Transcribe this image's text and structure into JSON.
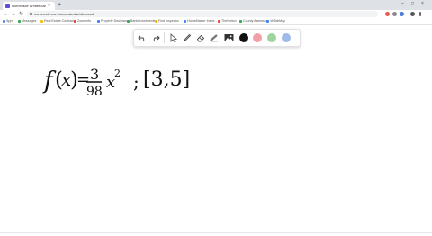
{
  "browser": {
    "tab_title": "Numerade Whiteboard",
    "tab_close": "×",
    "new_tab": "+",
    "url": "numerade.com/uncurated/whiteboard",
    "back": "←",
    "forward": "→",
    "reload": "↻",
    "min": "–",
    "max": "□",
    "close": "×"
  },
  "bookmarks": [
    {
      "label": "Apps",
      "color": "#4285f4"
    },
    {
      "label": "Messages",
      "color": "#34a853"
    },
    {
      "label": "Real Estate Contract",
      "color": "#fbbc05"
    },
    {
      "label": "Zoominfo",
      "color": "#ea4335"
    },
    {
      "label": "Property Disclosure",
      "color": "#4285f4"
    },
    {
      "label": "BankInvestments",
      "color": "#34a853"
    },
    {
      "label": "Find Inspector",
      "color": "#fbbc05"
    },
    {
      "label": "HomeMaster Inspe...",
      "color": "#4285f4"
    },
    {
      "label": "TheNotion",
      "color": "#ea4335"
    },
    {
      "label": "County Assessor",
      "color": "#34a853"
    },
    {
      "label": "VirTabMap",
      "color": "#4285f4"
    }
  ],
  "palette": {
    "tools": [
      "undo-icon",
      "redo-icon",
      "pen-icon",
      "eraser-icon",
      "highlighter-icon",
      "image-icon"
    ],
    "colors": [
      "#111111",
      "#f2a0a8",
      "#9fd39f",
      "#9dbbe8"
    ]
  },
  "whiteboard": {
    "f": "f",
    "open_paren": "(",
    "var": "x",
    "close_paren": ")",
    "equals": "=",
    "numerator": "3",
    "denominator": "98",
    "base": "x",
    "exponent": "2",
    "semicolon": ";",
    "interval": "[3,5]"
  }
}
